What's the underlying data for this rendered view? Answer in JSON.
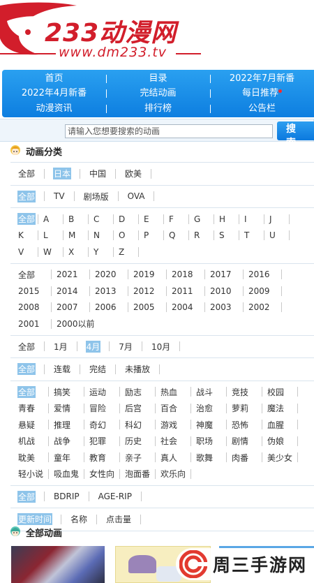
{
  "logo": {
    "name": "233动漫网",
    "url": "www.dm233.tv"
  },
  "nav": {
    "rows": [
      [
        "首页",
        "目录",
        "2022年7月新番"
      ],
      [
        "2022年4月新番",
        "完结动画",
        "每日推荐"
      ],
      [
        "动漫资讯",
        "排行榜",
        "公告栏"
      ]
    ]
  },
  "search": {
    "placeholder": "请输入您想要搜索的动画",
    "button_label": "搜 索"
  },
  "category_section": {
    "title": "动画分类"
  },
  "filters": {
    "region": {
      "items": [
        "全部",
        "日本",
        "中国",
        "欧美"
      ],
      "selected": "日本"
    },
    "format": {
      "items": [
        "全部",
        "TV",
        "剧场版",
        "OVA"
      ],
      "selected": "全部"
    },
    "letters": {
      "items": [
        "全部",
        "A",
        "B",
        "C",
        "D",
        "E",
        "F",
        "G",
        "H",
        "I",
        "J",
        "K",
        "L",
        "M",
        "N",
        "O",
        "P",
        "Q",
        "R",
        "S",
        "T",
        "U",
        "V",
        "W",
        "X",
        "Y",
        "Z"
      ],
      "selected": "全部"
    },
    "years": {
      "items": [
        "全部",
        "2021",
        "2020",
        "2019",
        "2018",
        "2017",
        "2016",
        "2015",
        "2014",
        "2013",
        "2012",
        "2011",
        "2010",
        "2009",
        "2008",
        "2007",
        "2006",
        "2005",
        "2004",
        "2003",
        "2002",
        "2001",
        "2000以前"
      ],
      "selected": ""
    },
    "months": {
      "items": [
        "全部",
        "1月",
        "4月",
        "7月",
        "10月"
      ],
      "selected": "4月"
    },
    "status": {
      "items": [
        "全部",
        "连载",
        "完结",
        "未播放"
      ],
      "selected": "全部"
    },
    "genres": {
      "items": [
        "全部",
        "搞笑",
        "运动",
        "励志",
        "热血",
        "战斗",
        "竞技",
        "校园",
        "青春",
        "爱情",
        "冒险",
        "后宫",
        "百合",
        "治愈",
        "萝莉",
        "魔法",
        "悬疑",
        "推理",
        "奇幻",
        "科幻",
        "游戏",
        "神魔",
        "恐怖",
        "血腥",
        "机战",
        "战争",
        "犯罪",
        "历史",
        "社会",
        "职场",
        "剧情",
        "伪娘",
        "耽美",
        "童年",
        "教育",
        "亲子",
        "真人",
        "歌舞",
        "肉番",
        "美少女",
        "轻小说",
        "吸血鬼",
        "女性向",
        "泡面番",
        "欢乐向"
      ],
      "selected": "全部"
    },
    "resource": {
      "items": [
        "全部",
        "BDRIP",
        "AGE-RIP"
      ],
      "selected": "全部"
    },
    "sort": {
      "items": [
        "更新时间",
        "名称",
        "点击量"
      ],
      "selected": "更新时间"
    }
  },
  "all_section": {
    "title": "全部动画"
  },
  "watermark": {
    "text": "周三手游网"
  },
  "colors": {
    "brand_red": "#d21e2b",
    "nav_blue": "#1a8fe8",
    "selected_bg": "#8ec4ea"
  }
}
